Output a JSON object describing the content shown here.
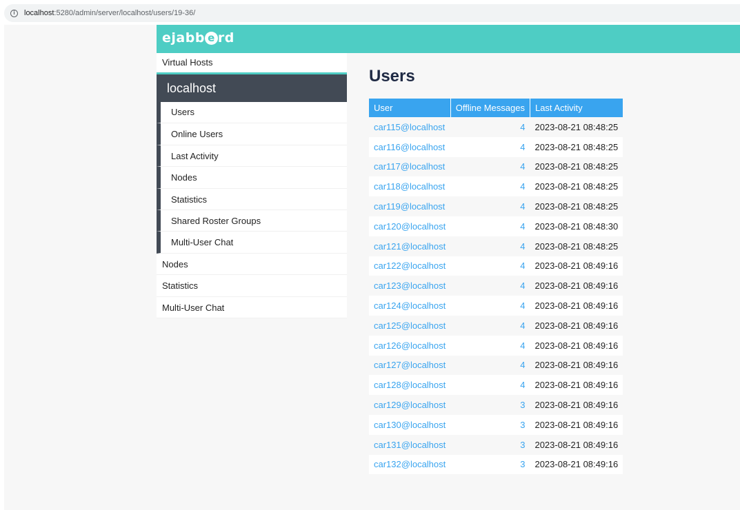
{
  "browser": {
    "url_host": "localhost",
    "url_rest": ":5280/admin/server/localhost/users/19-36/"
  },
  "logo": {
    "before": "ejabb",
    "circle": "e",
    "after": "rd"
  },
  "sidebar": {
    "top_link": "Virtual Hosts",
    "host_title": "localhost",
    "host_items": [
      {
        "label": "Users"
      },
      {
        "label": "Online Users"
      },
      {
        "label": "Last Activity"
      },
      {
        "label": "Nodes"
      },
      {
        "label": "Statistics"
      },
      {
        "label": "Shared Roster Groups"
      },
      {
        "label": "Multi-User Chat"
      }
    ],
    "global_items": [
      {
        "label": "Nodes"
      },
      {
        "label": "Statistics"
      },
      {
        "label": "Multi-User Chat"
      }
    ]
  },
  "main": {
    "title": "Users",
    "columns": {
      "user": "User",
      "offline": "Offline Messages",
      "activity": "Last Activity"
    },
    "rows": [
      {
        "user": "car115@localhost",
        "offline": "4",
        "activity": "2023-08-21 08:48:25"
      },
      {
        "user": "car116@localhost",
        "offline": "4",
        "activity": "2023-08-21 08:48:25"
      },
      {
        "user": "car117@localhost",
        "offline": "4",
        "activity": "2023-08-21 08:48:25"
      },
      {
        "user": "car118@localhost",
        "offline": "4",
        "activity": "2023-08-21 08:48:25"
      },
      {
        "user": "car119@localhost",
        "offline": "4",
        "activity": "2023-08-21 08:48:25"
      },
      {
        "user": "car120@localhost",
        "offline": "4",
        "activity": "2023-08-21 08:48:30"
      },
      {
        "user": "car121@localhost",
        "offline": "4",
        "activity": "2023-08-21 08:48:25"
      },
      {
        "user": "car122@localhost",
        "offline": "4",
        "activity": "2023-08-21 08:49:16"
      },
      {
        "user": "car123@localhost",
        "offline": "4",
        "activity": "2023-08-21 08:49:16"
      },
      {
        "user": "car124@localhost",
        "offline": "4",
        "activity": "2023-08-21 08:49:16"
      },
      {
        "user": "car125@localhost",
        "offline": "4",
        "activity": "2023-08-21 08:49:16"
      },
      {
        "user": "car126@localhost",
        "offline": "4",
        "activity": "2023-08-21 08:49:16"
      },
      {
        "user": "car127@localhost",
        "offline": "4",
        "activity": "2023-08-21 08:49:16"
      },
      {
        "user": "car128@localhost",
        "offline": "4",
        "activity": "2023-08-21 08:49:16"
      },
      {
        "user": "car129@localhost",
        "offline": "3",
        "activity": "2023-08-21 08:49:16"
      },
      {
        "user": "car130@localhost",
        "offline": "3",
        "activity": "2023-08-21 08:49:16"
      },
      {
        "user": "car131@localhost",
        "offline": "3",
        "activity": "2023-08-21 08:49:16"
      },
      {
        "user": "car132@localhost",
        "offline": "3",
        "activity": "2023-08-21 08:49:16"
      }
    ]
  },
  "colors": {
    "header": "#4ecdc4",
    "host_panel": "#424a55",
    "table_header": "#39a4ef",
    "link": "#39a4ef",
    "title": "#1f2a44"
  },
  "icons": {
    "site_info": "info-circle-icon"
  }
}
